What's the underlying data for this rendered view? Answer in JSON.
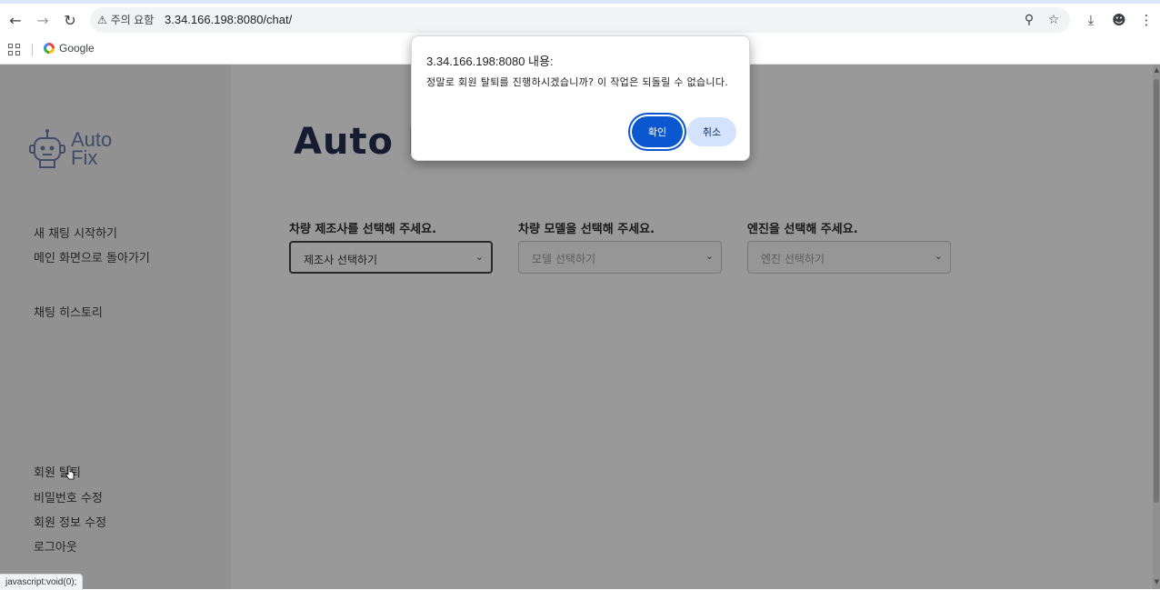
{
  "browser": {
    "warning_label": "주의 요함",
    "url": "3.34.166.198:8080/chat/",
    "bookmark_google": "Google"
  },
  "sidebar": {
    "logo_line1": "Auto",
    "logo_line2": "Fix",
    "new_chat": "새 채팅 시작하기",
    "back_main": "메인 화면으로 돌아가기",
    "chat_history": "채팅 히스토리",
    "withdraw": "회원 탈퇴",
    "change_password": "비밀번호 수정",
    "edit_info": "회원 정보 수정",
    "logout": "로그아웃"
  },
  "main": {
    "title": "Auto F",
    "manufacturer_label": "차량 제조사를 선택해 주세요.",
    "manufacturer_value": "제조사 선택하기",
    "model_label": "차량 모델을 선택해 주세요.",
    "model_value": "모델 선택하기",
    "engine_label": "엔진을 선택해 주세요.",
    "engine_value": "엔진 선택하기"
  },
  "dialog": {
    "title": "3.34.166.198:8080 내용:",
    "message": "정말로 회원 탈퇴를 진행하시겠습니까? 이 작업은 되돌릴 수 없습니다.",
    "ok_label": "확인",
    "cancel_label": "취소"
  },
  "statusbar": {
    "text": "javascript:void(0);"
  },
  "colors": {
    "accent": "#0b57d0",
    "cancel_bg": "#d3e3fd",
    "title": "#26304f"
  }
}
